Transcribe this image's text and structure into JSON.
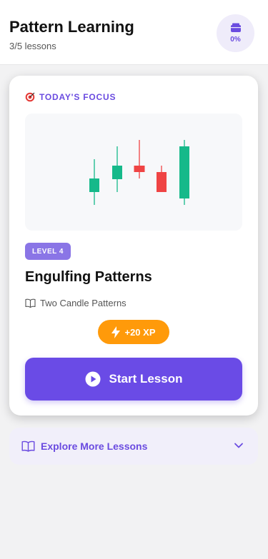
{
  "header": {
    "title": "Pattern Learning",
    "subtitle": "3/5 lessons",
    "progress_label": "0%",
    "progress_icon": "book-stack-icon"
  },
  "card": {
    "focus_icon": "target-icon",
    "focus_label": "TODAY'S FOCUS",
    "level_label": "LEVEL 4",
    "title": "Engulfing Patterns",
    "category_icon": "open-book-icon",
    "category": "Two Candle Patterns",
    "xp_icon": "lightning-icon",
    "xp_label": "+20 XP",
    "start_icon": "play-icon",
    "start_label": "Start Lesson"
  },
  "chart_data": {
    "type": "candlestick",
    "colors": {
      "up": "#16b98a",
      "down": "#ef4444"
    },
    "candles": [
      {
        "direction": "up"
      },
      {
        "direction": "up"
      },
      {
        "direction": "down"
      },
      {
        "direction": "down"
      },
      {
        "direction": "up"
      }
    ]
  },
  "explore": {
    "icon": "open-book-icon",
    "label": "Explore More Lessons",
    "chevron": "chevron-down-icon"
  },
  "colors": {
    "accent": "#6a4be6",
    "xp": "#ff9a0a",
    "level": "#8a75e6"
  }
}
